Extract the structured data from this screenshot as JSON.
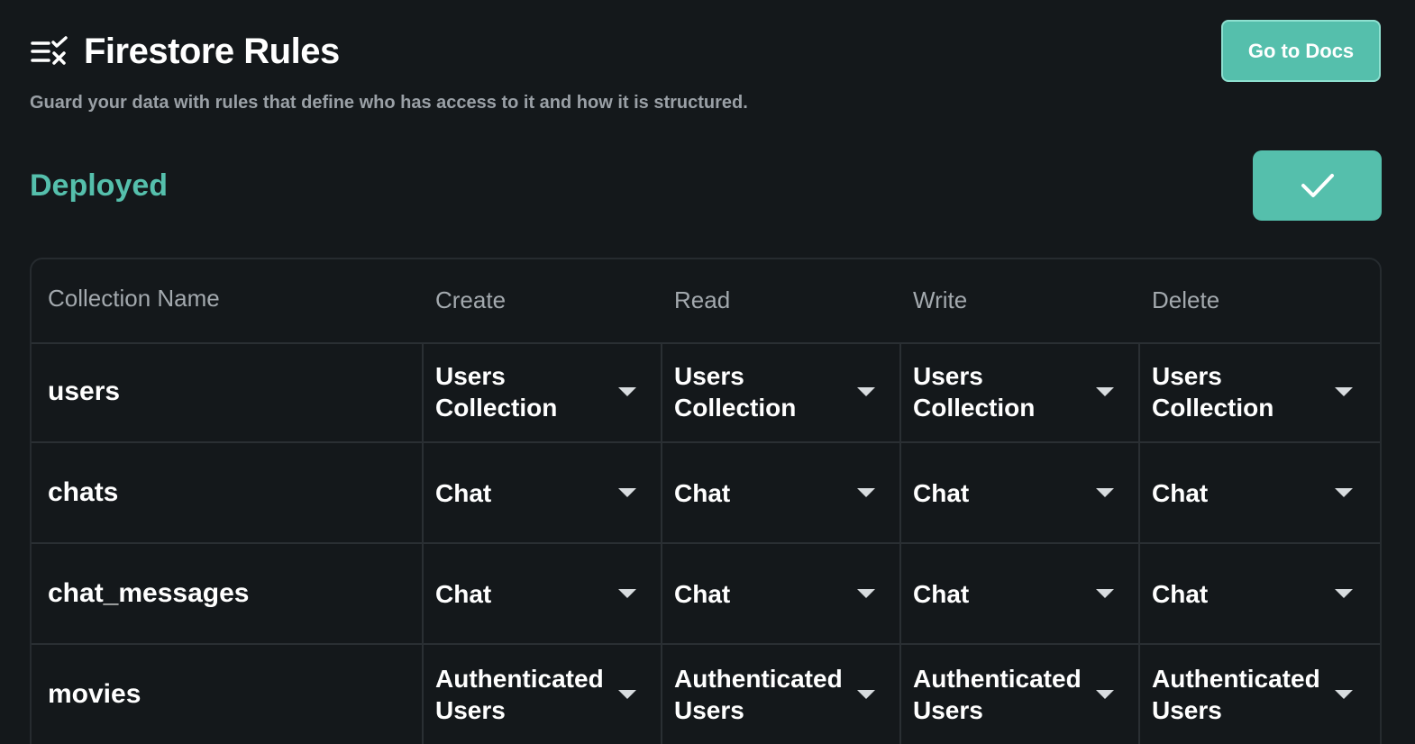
{
  "header": {
    "title": "Firestore Rules",
    "subtitle": "Guard your data with rules that define who has access to it and how it is structured.",
    "docs_button_label": "Go to Docs",
    "icon": "rules-checklist-icon"
  },
  "status": {
    "label": "Deployed",
    "deploy_icon": "check-icon",
    "accent_color": "#55bfac"
  },
  "table": {
    "columns": [
      "Collection Name",
      "Create",
      "Read",
      "Write",
      "Delete"
    ],
    "rows": [
      {
        "name": "users",
        "cells": [
          "Users Collection",
          "Users Collection",
          "Users Collection",
          "Users Collection"
        ]
      },
      {
        "name": "chats",
        "cells": [
          "Chat",
          "Chat",
          "Chat",
          "Chat"
        ]
      },
      {
        "name": "chat_messages",
        "cells": [
          "Chat",
          "Chat",
          "Chat",
          "Chat"
        ]
      },
      {
        "name": "movies",
        "cells": [
          "Authenticated Users",
          "Authenticated Users",
          "Authenticated Users",
          "Authenticated Users"
        ]
      }
    ]
  }
}
